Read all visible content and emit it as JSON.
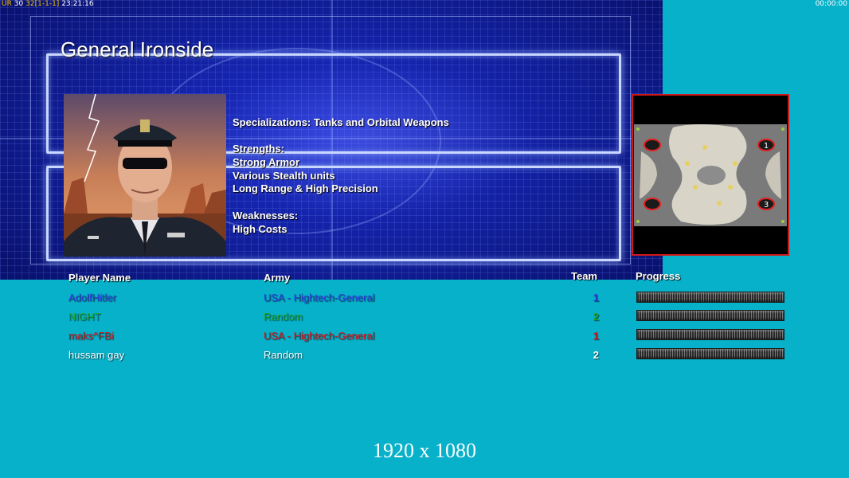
{
  "hud": {
    "top_left_ur": "UR",
    "top_left_a": "30",
    "top_left_b": "32",
    "top_left_c": "[1-1-1]",
    "top_left_time": "23:21:16",
    "top_right_time": "00:00:00"
  },
  "general": {
    "title": "General Ironside",
    "specializations": "Specializations: Tanks and Orbital Weapons",
    "strengths_label": "Strengths:",
    "strengths": [
      "Strong Armor",
      "Various Stealth units",
      "Long Range & High Precision"
    ],
    "weaknesses_label": "Weaknesses:",
    "weaknesses": [
      "High Costs"
    ]
  },
  "minimap": {
    "start_labels": [
      "1",
      "3"
    ]
  },
  "table": {
    "headers": {
      "player": "Player Name",
      "army": "Army",
      "team": "Team",
      "progress": "Progress"
    },
    "rows": [
      {
        "player": "AdolfHitler",
        "army": "USA - Hightech-General",
        "team": "1",
        "color": "#2d3fe0",
        "progress": 0
      },
      {
        "player": "NIGHT",
        "army": "Random",
        "team": "2",
        "color": "#1fa82a",
        "progress": 0
      },
      {
        "player": "maks^FBi",
        "army": "USA - Hightech-General",
        "team": "1",
        "color": "#d8141e",
        "progress": 0
      },
      {
        "player": "hussam gay",
        "army": "Random",
        "team": "2",
        "color": "#ffffff",
        "progress": 0
      }
    ]
  },
  "footer": {
    "resolution": "1920 x 1080"
  }
}
